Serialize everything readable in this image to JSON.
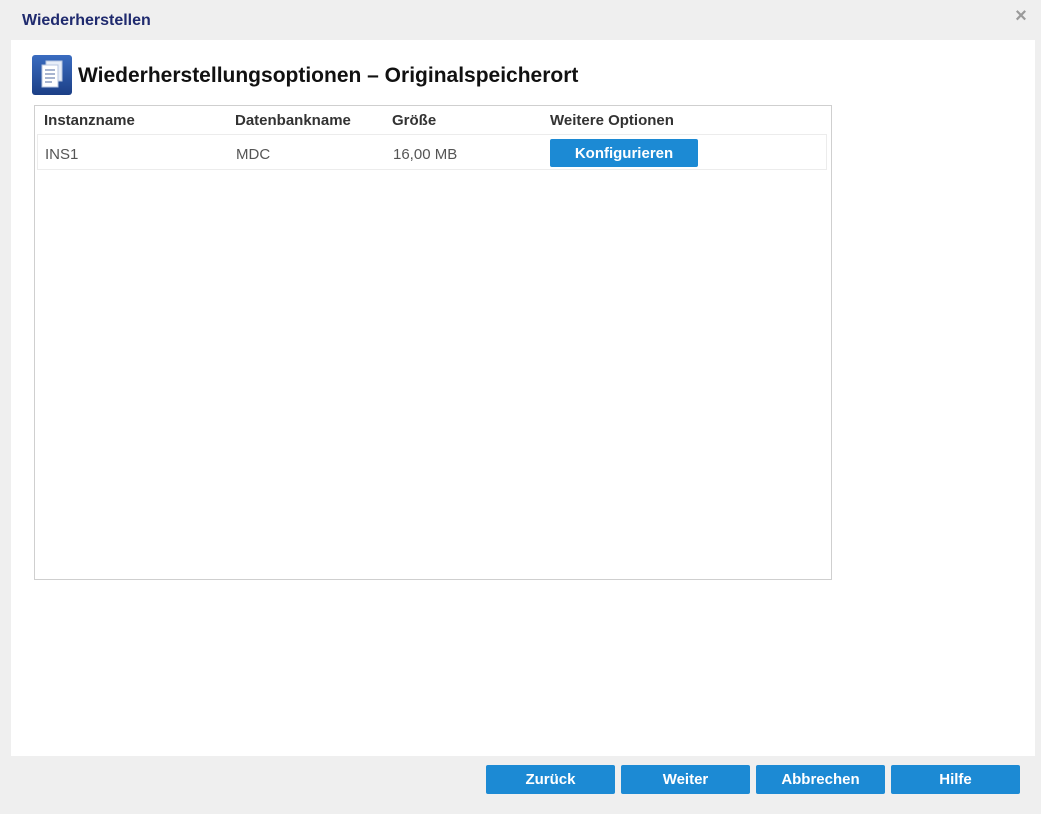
{
  "dialog": {
    "title": "Wiederherstellen",
    "close_glyph": "×"
  },
  "heading": {
    "icon": "documents-icon",
    "text": "Wiederherstellungsoptionen – Originalspeicherort"
  },
  "table": {
    "columns": [
      "Instanzname",
      "Datenbankname",
      "Größe",
      "Weitere Optionen"
    ],
    "rows": [
      {
        "instance": "INS1",
        "database": "MDC",
        "size": "16,00 MB",
        "action_label": "Konfigurieren"
      }
    ]
  },
  "footer": {
    "back_label": "Zurück",
    "next_label": "Weiter",
    "cancel_label": "Abbrechen",
    "help_label": "Hilfe"
  },
  "colors": {
    "button": "#1c8ad4",
    "title": "#1f2a6e",
    "dialog_bg": "#efefef"
  }
}
